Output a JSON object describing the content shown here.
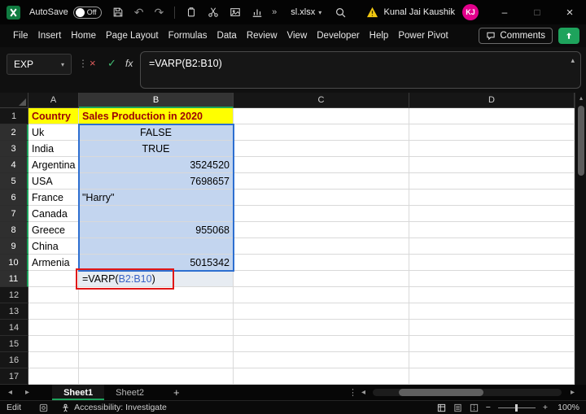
{
  "window": {
    "autosave_label": "AutoSave",
    "autosave_state": "Off",
    "filename": "sl.xlsx",
    "user_name": "Kunal Jai Kaushik",
    "user_initials": "KJ",
    "controls": {
      "minimize": "–",
      "maximize": "□",
      "close": "×"
    }
  },
  "glyphs": {
    "undo": "↶",
    "redo": "↷",
    "chevron_double": "»",
    "chevron_down": "▾",
    "chevron_up": "▴",
    "dots_vertical": "⋮",
    "nav_left": "◂",
    "nav_right": "▸",
    "add": "+",
    "cancel": "×",
    "enter": "✓",
    "zoom_out": "−",
    "zoom_in": "+",
    "scroll_up": "▲"
  },
  "menu": {
    "items": [
      "File",
      "Insert",
      "Home",
      "Page Layout",
      "Formulas",
      "Data",
      "Review",
      "View",
      "Developer",
      "Help",
      "Power Pivot"
    ],
    "comments_label": "Comments"
  },
  "formula_bar": {
    "name_box_value": "EXP",
    "fx_label": "fx",
    "formula": {
      "prefix": "=VARP(",
      "ref": "B2:B10",
      "suffix": ")"
    }
  },
  "grid": {
    "columns": [
      "A",
      "B",
      "C",
      "D"
    ],
    "selected_range": "B2:B10",
    "edit_cell": {
      "prefix": "=VARP(",
      "ref": "B2:B10",
      "suffix": ")"
    },
    "rows": [
      {
        "n": "1",
        "a": "Country",
        "b": "Sales Production in 2020"
      },
      {
        "n": "2",
        "a": "Uk",
        "b": "FALSE"
      },
      {
        "n": "3",
        "a": "India",
        "b": "TRUE"
      },
      {
        "n": "4",
        "a": "Argentina",
        "b": "3524520"
      },
      {
        "n": "5",
        "a": "USA",
        "b": "7698657"
      },
      {
        "n": "6",
        "a": "France",
        "b": "\"Harry\""
      },
      {
        "n": "7",
        "a": "Canada",
        "b": ""
      },
      {
        "n": "8",
        "a": "Greece",
        "b": "955068"
      },
      {
        "n": "9",
        "a": "China",
        "b": ""
      },
      {
        "n": "10",
        "a": "Armenia",
        "b": "5015342"
      },
      {
        "n": "11",
        "a": "",
        "b": "",
        "edit": true
      },
      {
        "n": "12",
        "a": "",
        "b": ""
      },
      {
        "n": "13",
        "a": "",
        "b": ""
      },
      {
        "n": "14",
        "a": "",
        "b": ""
      },
      {
        "n": "15",
        "a": "",
        "b": ""
      },
      {
        "n": "16",
        "a": "",
        "b": ""
      },
      {
        "n": "17",
        "a": "",
        "b": ""
      }
    ]
  },
  "sheet_tabs": {
    "tabs": [
      {
        "label": "Sheet1",
        "active": true
      },
      {
        "label": "Sheet2",
        "active": false
      }
    ],
    "add_label": "+"
  },
  "status_bar": {
    "mode": "Edit",
    "accessibility": "Accessibility: Investigate",
    "zoom_level": "100%"
  },
  "colors": {
    "accent_green": "#1ea35c",
    "header_fill": "#ffff00",
    "header_text": "#9c0006",
    "range_fill": "#c3d5ef",
    "range_border": "#2e6fd0",
    "ref_text": "#3b63c4",
    "annotation_red": "#e01717",
    "avatar_pink": "#e3008c"
  }
}
